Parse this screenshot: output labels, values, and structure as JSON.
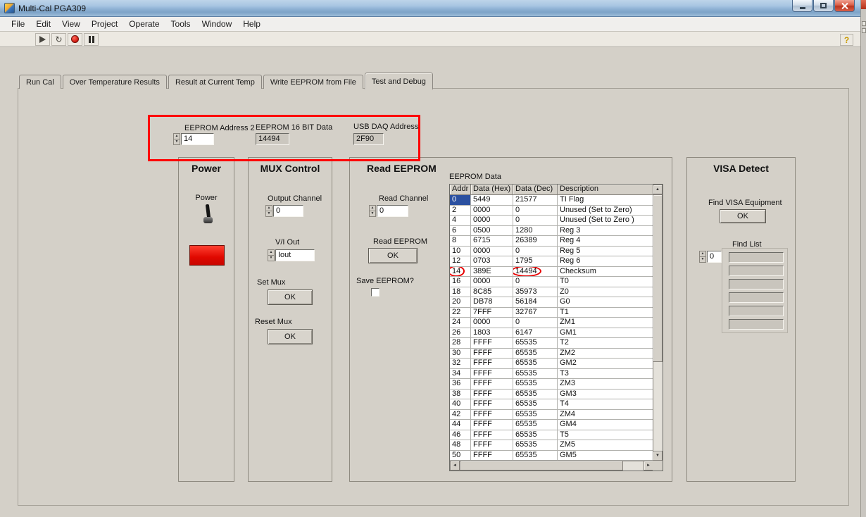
{
  "window": {
    "title": "Multi-Cal PGA309"
  },
  "menu": {
    "items": [
      "File",
      "Edit",
      "View",
      "Project",
      "Operate",
      "Tools",
      "Window",
      "Help"
    ]
  },
  "toolbar": {
    "help_label": "?",
    "icons": [
      "run-icon",
      "continuous-run-icon",
      "abort-icon",
      "pause-icon"
    ]
  },
  "tabs": [
    {
      "label": "Run Cal"
    },
    {
      "label": "Over Temperature Results"
    },
    {
      "label": "Result at Current Temp"
    },
    {
      "label": "Write EEPROM from File"
    },
    {
      "label": "Test and Debug"
    }
  ],
  "debug_fields": {
    "eeprom_address2_label": "EEPROM Address 2",
    "eeprom_address2_value": "14",
    "eeprom_16bit_label": "EEPROM 16 BIT Data",
    "eeprom_16bit_value": "14494",
    "usb_daq_label": "USB DAQ Address",
    "usb_daq_value": "2F90"
  },
  "power": {
    "title": "Power",
    "switch_label": "Power",
    "led_color": "#ff0000"
  },
  "mux": {
    "title": "MUX Control",
    "output_channel_label": "Output Channel",
    "output_channel_value": "0",
    "vi_out_label": "V/I Out",
    "vi_out_value": "Iout",
    "set_mux_label": "Set Mux",
    "set_mux_button": "OK",
    "reset_mux_label": "Reset Mux",
    "reset_mux_button": "OK"
  },
  "read_eeprom": {
    "title": "Read EEPROM",
    "read_channel_label": "Read Channel",
    "read_channel_value": "0",
    "read_button_label": "Read EEPROM",
    "read_button": "OK",
    "save_label": "Save EEPROM?",
    "table_title": "EEPROM Data",
    "columns": [
      "Addr",
      "Data (Hex)",
      "Data (Dec)",
      "Description"
    ],
    "rows": [
      [
        "0",
        "5449",
        "21577",
        "TI Flag"
      ],
      [
        "2",
        "0000",
        "0",
        "Unused (Set to Zero)"
      ],
      [
        "4",
        "0000",
        "0",
        "Unused (Set to Zero )"
      ],
      [
        "6",
        "0500",
        "1280",
        "Reg 3"
      ],
      [
        "8",
        "6715",
        "26389",
        "Reg 4"
      ],
      [
        "10",
        "0000",
        "0",
        "Reg 5"
      ],
      [
        "12",
        "0703",
        "1795",
        "Reg 6"
      ],
      [
        "14",
        "389E",
        "14494",
        "Checksum"
      ],
      [
        "16",
        "0000",
        "0",
        "T0"
      ],
      [
        "18",
        "8C85",
        "35973",
        "Z0"
      ],
      [
        "20",
        "DB78",
        "56184",
        "G0"
      ],
      [
        "22",
        "7FFF",
        "32767",
        "T1"
      ],
      [
        "24",
        "0000",
        "0",
        "ZM1"
      ],
      [
        "26",
        "1803",
        "6147",
        "GM1"
      ],
      [
        "28",
        "FFFF",
        "65535",
        "T2"
      ],
      [
        "30",
        "FFFF",
        "65535",
        "ZM2"
      ],
      [
        "32",
        "FFFF",
        "65535",
        "GM2"
      ],
      [
        "34",
        "FFFF",
        "65535",
        "T3"
      ],
      [
        "36",
        "FFFF",
        "65535",
        "ZM3"
      ],
      [
        "38",
        "FFFF",
        "65535",
        "GM3"
      ],
      [
        "40",
        "FFFF",
        "65535",
        "T4"
      ],
      [
        "42",
        "FFFF",
        "65535",
        "ZM4"
      ],
      [
        "44",
        "FFFF",
        "65535",
        "GM4"
      ],
      [
        "46",
        "FFFF",
        "65535",
        "T5"
      ],
      [
        "48",
        "FFFF",
        "65535",
        "ZM5"
      ],
      [
        "50",
        "FFFF",
        "65535",
        "GM5"
      ]
    ],
    "selected_cell": {
      "row_addr": "0",
      "column": "Addr"
    },
    "circled_row_addr": "14"
  },
  "visa": {
    "title": "VISA Detect",
    "find_button_label": "Find VISA Equipment",
    "find_button": "OK",
    "find_list_label": "Find List",
    "find_list_value": "0"
  },
  "colors": {
    "annotation_red": "#ff0000",
    "selection_blue": "#2b50a0",
    "led_red": "#ff0000"
  }
}
